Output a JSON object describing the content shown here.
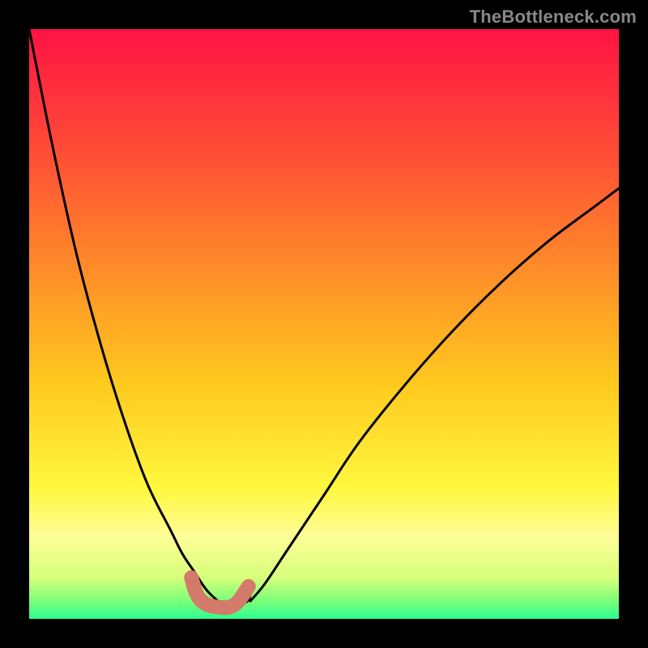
{
  "watermark": "TheBottleneck.com",
  "chart_data": {
    "type": "line",
    "title": "",
    "xlabel": "",
    "ylabel": "",
    "xlim": [
      0,
      100
    ],
    "ylim": [
      0,
      100
    ],
    "grid": false,
    "legend": false,
    "series": [
      {
        "name": "curve-left",
        "x": [
          0,
          4,
          8,
          12,
          16,
          20,
          24,
          26,
          28,
          30,
          32,
          33
        ],
        "values": [
          100,
          80,
          62,
          47,
          34,
          23,
          15,
          11,
          8,
          5,
          3,
          2
        ]
      },
      {
        "name": "curve-right",
        "x": [
          37.5,
          40,
          44,
          50,
          56,
          64,
          72,
          80,
          88,
          96,
          100
        ],
        "values": [
          3,
          6,
          12,
          21,
          30,
          40,
          49,
          57,
          64,
          70,
          73
        ]
      },
      {
        "name": "bottom-lobe",
        "x": [
          27,
          29,
          31,
          33,
          35,
          37,
          37.5
        ],
        "values": [
          5,
          3,
          2,
          2,
          2,
          3,
          4
        ]
      }
    ],
    "background_gradient": {
      "stops": [
        {
          "pos": 0.0,
          "color": "#ff1344"
        },
        {
          "pos": 0.2,
          "color": "#ff4a36"
        },
        {
          "pos": 0.4,
          "color": "#ff8a2a"
        },
        {
          "pos": 0.6,
          "color": "#ffc91e"
        },
        {
          "pos": 0.78,
          "color": "#fff83f"
        },
        {
          "pos": 0.86,
          "color": "#fffd98"
        },
        {
          "pos": 0.93,
          "color": "#d7ff7a"
        },
        {
          "pos": 0.97,
          "color": "#7aff7a"
        },
        {
          "pos": 1.0,
          "color": "#2cff8f"
        }
      ]
    },
    "highlight_marker": {
      "stroke": "#d47a6a",
      "points": [
        {
          "x": 27.5,
          "y": 7
        },
        {
          "x": 28.5,
          "y": 4
        },
        {
          "x": 30,
          "y": 2.5
        },
        {
          "x": 32,
          "y": 2
        },
        {
          "x": 34,
          "y": 2
        },
        {
          "x": 35.5,
          "y": 3
        },
        {
          "x": 37.2,
          "y": 5.5
        }
      ]
    }
  }
}
